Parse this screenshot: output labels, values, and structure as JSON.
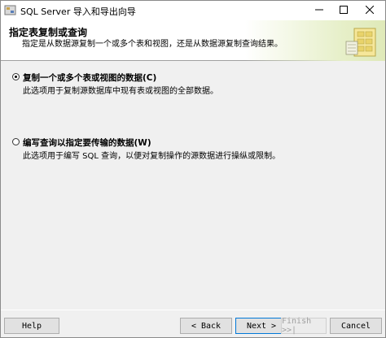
{
  "window": {
    "title": "SQL Server 导入和导出向导"
  },
  "header": {
    "title": "指定表复制或查询",
    "subtitle": "指定是从数据源复制一个或多个表和视图，还是从数据源复制查询结果。"
  },
  "options": [
    {
      "label": "复制一个或多个表或视图的数据(C)",
      "description": "此选项用于复制源数据库中现有表或视图的全部数据。",
      "selected": true
    },
    {
      "label": "编写查询以指定要传输的数据(W)",
      "description": "此选项用于编写 SQL 查询，以便对复制操作的源数据进行操纵或限制。",
      "selected": false
    }
  ],
  "buttons": {
    "help": "Help",
    "back": "< Back",
    "next": "Next >",
    "finish": "Finish >>|",
    "cancel": "Cancel"
  },
  "icons": {
    "app": "sql-server-wizard-icon",
    "minimize": "minimize-icon",
    "maximize": "maximize-icon",
    "close": "close-icon",
    "header": "wizard-banner-graphic"
  }
}
